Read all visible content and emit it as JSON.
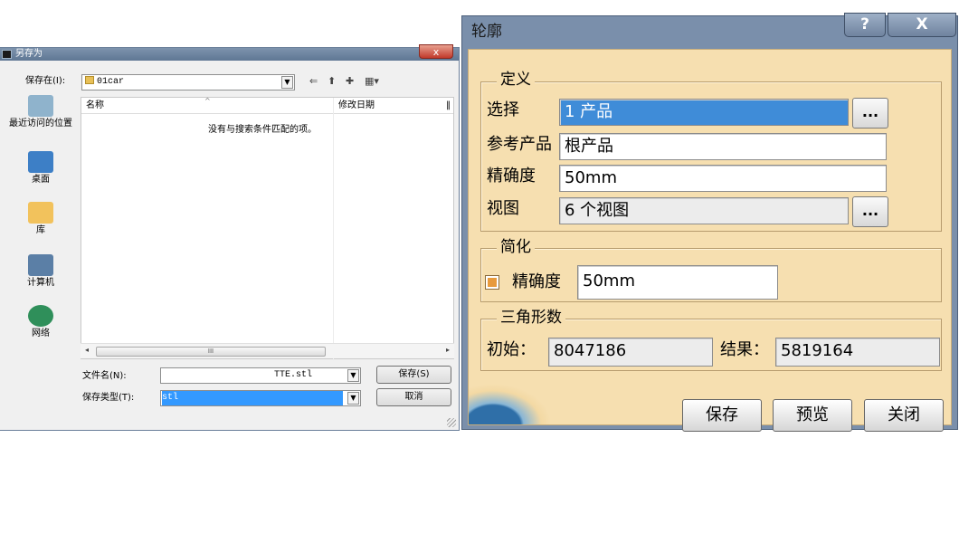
{
  "saveas": {
    "title": "另存为",
    "close_glyph": "x",
    "save_in_label": "保存在(I):",
    "folder": "01car",
    "places": [
      {
        "label": "最近访问的位置",
        "icon": "recent-places-icon",
        "color": "#8fb3cc"
      },
      {
        "label": "桌面",
        "icon": "desktop-icon",
        "color": "#3d7fc6"
      },
      {
        "label": "库",
        "icon": "library-icon",
        "color": "#f2c25c"
      },
      {
        "label": "计算机",
        "icon": "computer-icon",
        "color": "#5b7fa6"
      },
      {
        "label": "网络",
        "icon": "network-icon",
        "color": "#2f8f5a"
      }
    ],
    "columns": {
      "name": "名称",
      "modified": "修改日期",
      "more": "‖"
    },
    "empty_message": "没有与搜索条件匹配的项。",
    "scroll_thumb": "III",
    "filename_label": "文件名(N):",
    "filename_value": "TTE.stl",
    "filetype_label": "保存类型(T):",
    "filetype_value": "stl",
    "save_button": "保存(S)",
    "cancel_button": "取消"
  },
  "contour": {
    "title": "轮廓",
    "help_glyph": "?",
    "close_glyph": "X",
    "definition": {
      "title": "定义",
      "select_label": "选择",
      "select_value": "1 产品",
      "ref_label": "参考产品",
      "ref_value": "根产品",
      "precision_label": "精确度",
      "precision_value": "50mm",
      "view_label": "视图",
      "view_value": "6 个视图",
      "ellipsis": "..."
    },
    "simplify": {
      "title": "简化",
      "precision_label": "精确度",
      "precision_value": "50mm"
    },
    "triangles": {
      "title": "三角形数",
      "initial_label": "初始：",
      "initial_value": "8047186",
      "result_label": "结果：",
      "result_value": "5819164"
    },
    "buttons": {
      "save": "保存",
      "preview": "预览",
      "close": "关闭"
    }
  }
}
